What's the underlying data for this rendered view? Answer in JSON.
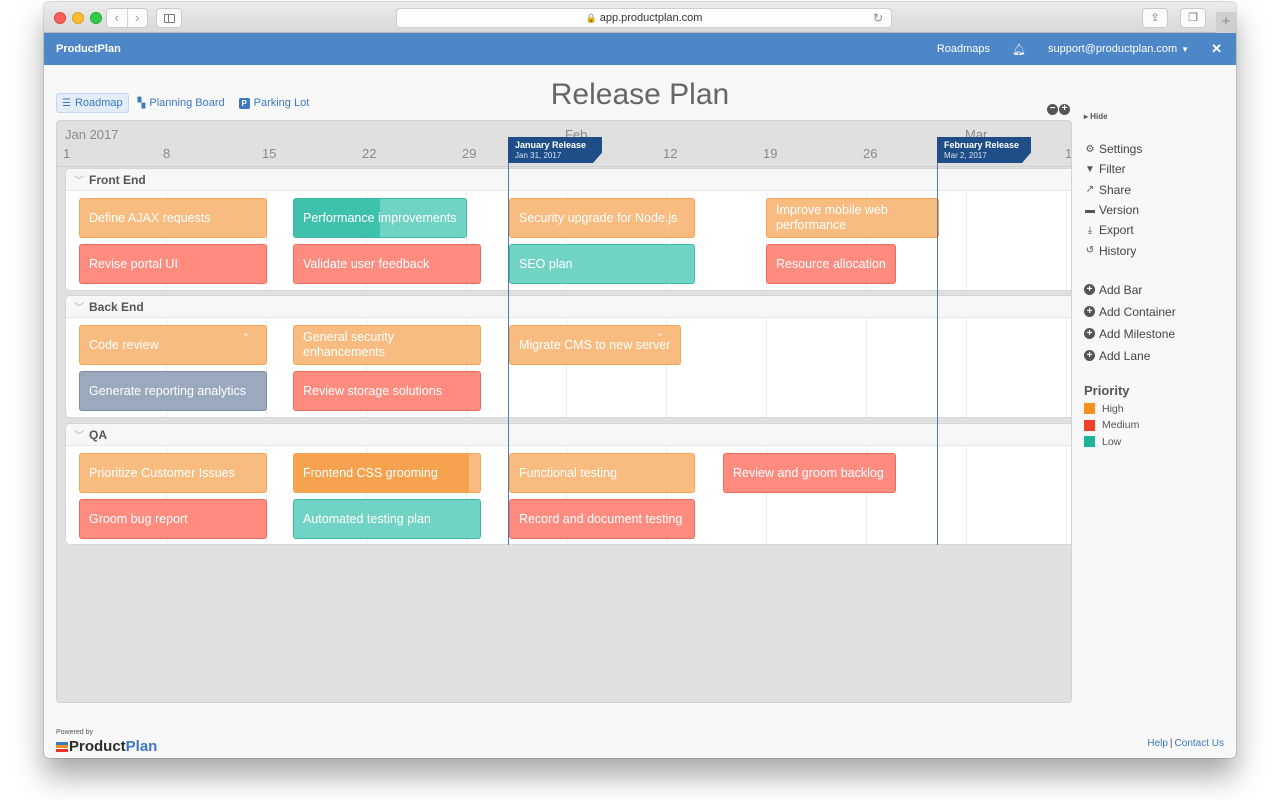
{
  "browser": {
    "url": "app.productplan.com",
    "nav_back": "‹",
    "nav_forward": "›",
    "new_tab": "+"
  },
  "app_nav": {
    "brand": "ProductPlan",
    "roadmaps_link": "Roadmaps",
    "user_menu": "support@productplan.com"
  },
  "view_tabs": [
    {
      "label": "Roadmap",
      "icon": "roadmap-icon",
      "active": true
    },
    {
      "label": "Planning Board",
      "icon": "planning-board-icon",
      "active": false
    },
    {
      "label": "Parking Lot",
      "icon": "parking-lot-icon",
      "active": false
    }
  ],
  "page_title": "Release Plan",
  "timeline": {
    "months": [
      {
        "label": "Jan 2017"
      },
      {
        "label": "Feb"
      },
      {
        "label": "Mar"
      }
    ],
    "days": [
      "1",
      "8",
      "15",
      "22",
      "29",
      "12",
      "19",
      "26",
      "1"
    ]
  },
  "milestones": [
    {
      "name": "January Release",
      "date": "Jan 31, 2017"
    },
    {
      "name": "February Release",
      "date": "Mar 2, 2017"
    }
  ],
  "lanes": [
    {
      "name": "Front End",
      "bars": [
        {
          "label": "Define AJAX requests",
          "priority": "high"
        },
        {
          "label": "Performance improvements",
          "priority": "low",
          "progress_percent": 50
        },
        {
          "label": "Security upgrade for Node.js",
          "priority": "high"
        },
        {
          "label": "Improve mobile web performance",
          "priority": "high"
        },
        {
          "label": "Revise portal UI",
          "priority": "medium"
        },
        {
          "label": "Validate user feedback",
          "priority": "medium"
        },
        {
          "label": "SEO plan",
          "priority": "low"
        },
        {
          "label": "Resource allocation",
          "priority": "medium"
        }
      ]
    },
    {
      "name": "Back End",
      "bars": [
        {
          "label": "Code review",
          "priority": "high"
        },
        {
          "label": "General security enhancements",
          "priority": "high"
        },
        {
          "label": "Migrate CMS to new server",
          "priority": "high"
        },
        {
          "label": "Generate reporting analytics",
          "priority": "none"
        },
        {
          "label": "Review storage solutions",
          "priority": "medium"
        }
      ]
    },
    {
      "name": "QA",
      "bars": [
        {
          "label": "Prioritize Customer Issues",
          "priority": "high"
        },
        {
          "label": "Frontend CSS grooming",
          "priority": "high",
          "progress_percent": 94
        },
        {
          "label": "Functional testing",
          "priority": "high"
        },
        {
          "label": "Review and groom backlog",
          "priority": "medium"
        },
        {
          "label": "Groom bug report",
          "priority": "medium"
        },
        {
          "label": "Automated testing plan",
          "priority": "low"
        },
        {
          "label": "Record and document testing",
          "priority": "medium"
        }
      ]
    }
  ],
  "right_panel": {
    "hide_label": "Hide",
    "actions": [
      {
        "label": "Settings",
        "icon": "gear-icon"
      },
      {
        "label": "Filter",
        "icon": "filter-icon"
      },
      {
        "label": "Share",
        "icon": "share-icon"
      },
      {
        "label": "Version",
        "icon": "archive-icon"
      },
      {
        "label": "Export",
        "icon": "download-icon"
      },
      {
        "label": "History",
        "icon": "history-icon"
      }
    ],
    "add_actions": [
      {
        "label": "Add Bar"
      },
      {
        "label": "Add Container"
      },
      {
        "label": "Add Milestone"
      },
      {
        "label": "Add Lane"
      }
    ],
    "legend": {
      "title": "Priority",
      "items": [
        {
          "label": "High",
          "color": "#f7901e"
        },
        {
          "label": "Medium",
          "color": "#f2412b"
        },
        {
          "label": "Low",
          "color": "#1bb39a"
        }
      ]
    }
  },
  "footer": {
    "powered_by": "Powered by",
    "logo_product": "Product",
    "logo_plan": "Plan",
    "help": "Help",
    "separator": "|",
    "contact": "Contact Us"
  }
}
